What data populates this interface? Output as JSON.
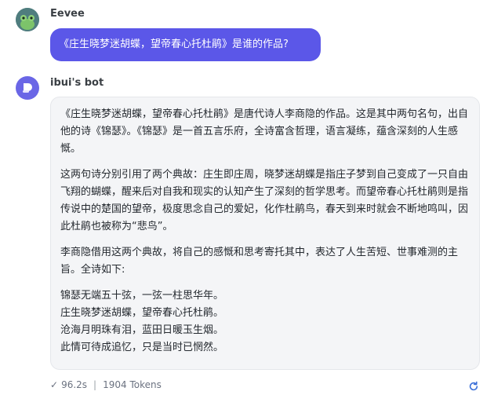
{
  "user": {
    "name": "Eevee",
    "message": "《庄生晓梦迷胡蝶，望帝春心托杜鹃》是谁的作品?"
  },
  "bot": {
    "name": "ibui's bot",
    "paragraphs": [
      "《庄生晓梦迷胡蝶，望帝春心托杜鹃》是唐代诗人李商隐的作品。这是其中两句名句，出自他的诗《锦瑟》。《锦瑟》是一首五言乐府，全诗富含哲理，语言凝练，蕴含深刻的人生感慨。",
      "这两句诗分别引用了两个典故：庄生即庄周，晓梦迷胡蝶是指庄子梦到自己变成了一只自由飞翔的蝴蝶，醒来后对自我和现实的认知产生了深刻的哲学思考。而望帝春心托杜鹃则是指传说中的楚国的望帝，极度思念自己的爱妃，化作杜鹃鸟，春天到来时就会不断地鸣叫，因此杜鹃也被称为“悲鸟”。",
      "李商隐借用这两个典故，将自己的感慨和思考寄托其中，表达了人生苦短、世事难测的主旨。全诗如下:"
    ],
    "poem": [
      "锦瑟无端五十弦，一弦一柱思华年。",
      "庄生晓梦迷胡蝶，望帝春心托杜鹃。",
      "沧海月明珠有泪，蓝田日暖玉生烟。",
      "此情可待成追忆，只是当时已惘然。"
    ]
  },
  "footer": {
    "time": "96.2s",
    "tokens": "1904 Tokens"
  },
  "colors": {
    "user_bubble": "#5b57e8",
    "bot_avatar": "#6a66e6",
    "bot_bubble": "#f4f5f7",
    "refresh_icon": "#3b6fd8"
  }
}
